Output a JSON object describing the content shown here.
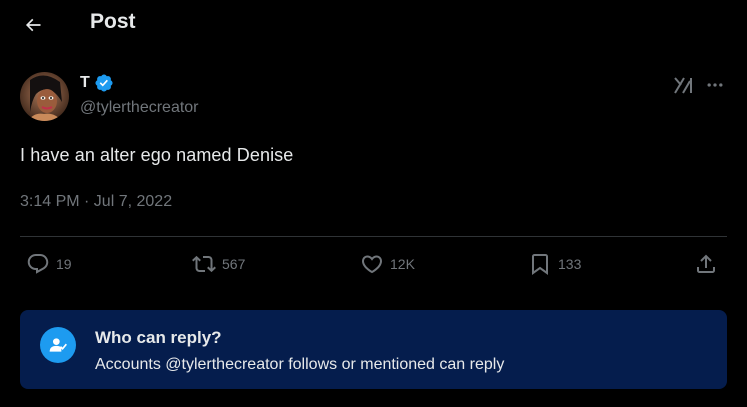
{
  "header": {
    "title": "Post",
    "back_icon": "arrow-left-icon"
  },
  "author": {
    "display_name": "T",
    "handle": "@tylerthecreator",
    "verified_color": "#1d9bf0"
  },
  "tweet": {
    "text": "I have an alter ego named Denise",
    "timestamp": "3:14 PM · Jul 7, 2022"
  },
  "actions": {
    "replies": "19",
    "reposts": "567",
    "likes": "12K",
    "bookmarks": "133"
  },
  "reply_restriction": {
    "title": "Who can reply?",
    "subtitle": "Accounts @tylerthecreator follows or mentioned can reply",
    "bg_color": "#051d4d",
    "icon_color": "#1d9bf0"
  },
  "colors": {
    "background": "#000000",
    "text_primary": "#e7e9ea",
    "text_secondary": "#71767b",
    "divider": "#2f3336"
  }
}
